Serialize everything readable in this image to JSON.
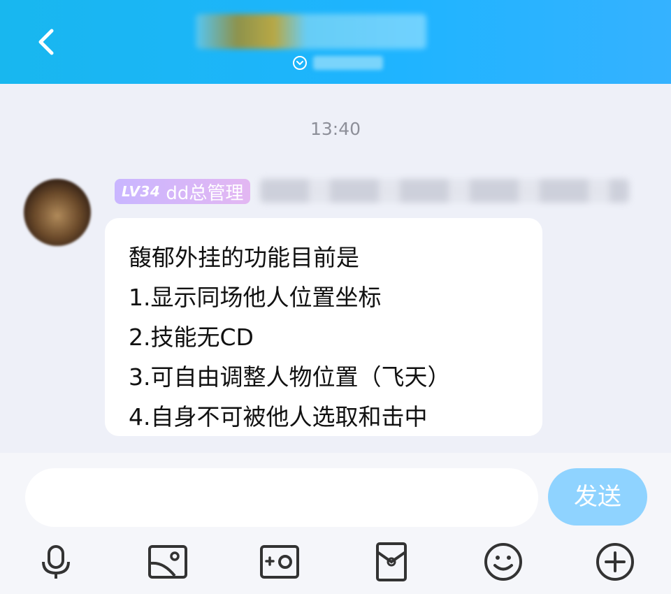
{
  "header": {
    "title": "",
    "subtitle": "",
    "back_icon": "chevron-left-icon"
  },
  "chat": {
    "timestamp": "13:40",
    "message": {
      "level": "LV34",
      "role": "dd总管理",
      "sender": "",
      "lines": [
        "馥郁外挂的功能目前是",
        "1.显示同场他人位置坐标",
        "2.技能无CD",
        "3.可自由调整人物位置（飞天）",
        "4.自身不可被他人选取和击中"
      ]
    }
  },
  "composer": {
    "input_value": "",
    "send_label": "发送",
    "tools": [
      "microphone-icon",
      "image-icon",
      "camera-icon",
      "red-packet-icon",
      "emoji-icon",
      "plus-icon"
    ]
  },
  "colors": {
    "header_accent": "#1fb4ff",
    "send_button": "#8fd3ff",
    "badge": "#d5b6f7",
    "background": "#eef0f8"
  }
}
